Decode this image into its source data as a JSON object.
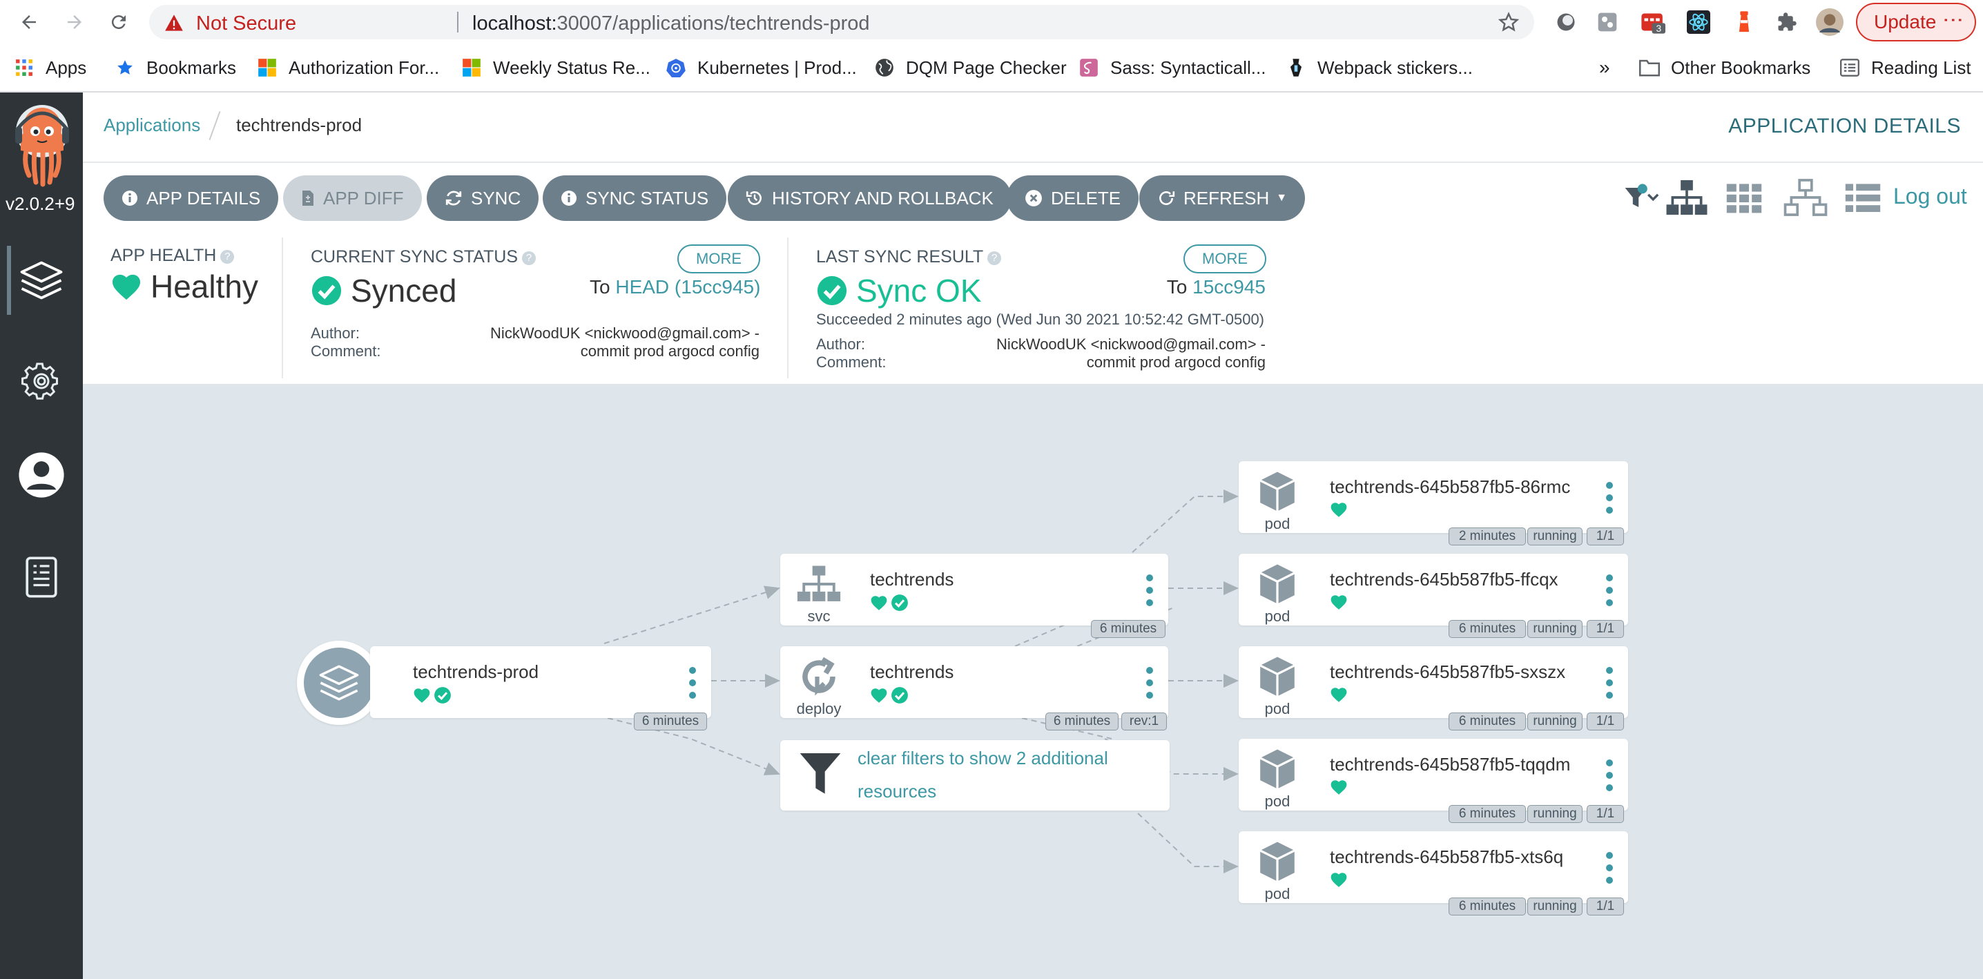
{
  "browser": {
    "not_secure": "Not Secure",
    "url_host": "localhost:",
    "url_path": "30007/applications/techtrends-prod",
    "update_label": "Update",
    "ext_badge": "3",
    "bookmarks": [
      {
        "label": "Apps",
        "icon": "apps-grid-icon"
      },
      {
        "label": "Bookmarks",
        "icon": "star-icon"
      },
      {
        "label": "Authorization For...",
        "icon": "microsoft-icon"
      },
      {
        "label": "Weekly Status Re...",
        "icon": "microsoft-icon"
      },
      {
        "label": "Kubernetes | Prod...",
        "icon": "kubernetes-icon"
      },
      {
        "label": "DQM Page Checker",
        "icon": "globe-icon"
      },
      {
        "label": "Sass: Syntacticall...",
        "icon": "sass-icon"
      },
      {
        "label": "Webpack stickers...",
        "icon": "webpack-icon"
      }
    ],
    "overflow": "»",
    "other_bookmarks": "Other Bookmarks",
    "reading_list": "Reading List"
  },
  "sidebar": {
    "version": "v2.0.2+9"
  },
  "header": {
    "breadcrumb_root": "Applications",
    "breadcrumb_current": "techtrends-prod",
    "page_title": "APPLICATION DETAILS"
  },
  "toolbar": {
    "app_details": "APP DETAILS",
    "app_diff": "APP DIFF",
    "sync": "SYNC",
    "sync_status": "SYNC STATUS",
    "history": "HISTORY AND ROLLBACK",
    "delete": "DELETE",
    "refresh": "REFRESH",
    "logout": "Log out"
  },
  "status": {
    "health_label": "APP HEALTH",
    "health_value": "Healthy",
    "sync_label": "CURRENT SYNC STATUS",
    "sync_value": "Synced",
    "more": "MORE",
    "to_label": "To",
    "to_head": "HEAD (15cc945)",
    "author_label": "Author:",
    "comment_label": "Comment:",
    "author_value": "NickWoodUK <nickwood@gmail.com> -",
    "comment_value": "commit prod argocd config",
    "last_label": "LAST SYNC RESULT",
    "last_value": "Sync OK",
    "last_to": "15cc945",
    "succeeded": "Succeeded 2 minutes ago (Wed Jun 30 2021 10:52:42 GMT-0500)"
  },
  "graph": {
    "app": {
      "name": "techtrends-prod",
      "age": "6 minutes"
    },
    "svc": {
      "name": "techtrends",
      "kind": "svc",
      "age": "6 minutes"
    },
    "deploy": {
      "name": "techtrends",
      "kind": "deploy",
      "age": "6 minutes",
      "rev": "rev:1"
    },
    "filter_text": "clear filters to show 2 additional resources",
    "pods": [
      {
        "name": "techtrends-645b587fb5-86rmc",
        "kind": "pod",
        "age": "2 minutes",
        "state": "running",
        "ready": "1/1"
      },
      {
        "name": "techtrends-645b587fb5-ffcqx",
        "kind": "pod",
        "age": "6 minutes",
        "state": "running",
        "ready": "1/1"
      },
      {
        "name": "techtrends-645b587fb5-sxszx",
        "kind": "pod",
        "age": "6 minutes",
        "state": "running",
        "ready": "1/1"
      },
      {
        "name": "techtrends-645b587fb5-tqqdm",
        "kind": "pod",
        "age": "6 minutes",
        "state": "running",
        "ready": "1/1"
      },
      {
        "name": "techtrends-645b587fb5-xts6q",
        "kind": "pod",
        "age": "6 minutes",
        "state": "running",
        "ready": "1/1"
      }
    ]
  },
  "colors": {
    "accent": "#3d98a5",
    "healthy": "#18be94",
    "button": "#6d7f8b",
    "sidebar": "#2f3438",
    "canvas": "#dee6eb"
  }
}
